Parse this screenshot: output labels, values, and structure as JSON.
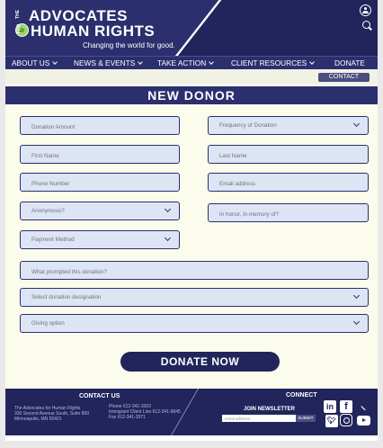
{
  "header": {
    "logo_the": "THE",
    "logo_line1": "ADVOCATES",
    "logo_for": "FOR",
    "logo_line2": "HUMAN RIGHTS",
    "tagline": "Changing the world for good."
  },
  "nav": {
    "items": [
      {
        "label": "ABOUT US"
      },
      {
        "label": "NEWS & EVENTS"
      },
      {
        "label": "TAKE ACTION"
      },
      {
        "label": "CLIENT RESOURCES"
      },
      {
        "label": "DONATE"
      }
    ]
  },
  "contact_button": "CONTACT",
  "page_title": "NEW DONOR",
  "form": {
    "donation_amount": "Donation Amount",
    "frequency": "Frequency of Donation",
    "first_name": "First Name",
    "last_name": "Last Name",
    "phone": "Phone Number",
    "email": "Email address",
    "anonymous": "Anonymous?",
    "in_honor": "In honor, in memory of?",
    "payment_method": "Payment Method",
    "prompted": "What prompted this donation?",
    "designation": "Select donation designation",
    "giving_option": "Giving option",
    "donate_button": "DONATE NOW"
  },
  "footer": {
    "contact_title": "CONTACT US",
    "address_line1": "The Advocates for Human Rights",
    "address_line2": "330 Second Avenue South, Suite 800",
    "address_line3": "Minneapolis, MN 55401",
    "phone_line1": "Phone 612-341-3302",
    "phone_line2": "Immigrant Client Line 612-341-9845",
    "phone_line3": "Fax 612-341-2971",
    "connect_title": "CONNECT",
    "newsletter_title": "JOIN NEWSLETTER",
    "newsletter_placeholder": "email address",
    "submit_label": "SUBMIT",
    "social_icons": [
      "linkedin-icon",
      "facebook-icon",
      "blog-icon",
      "twitter-icon",
      "instagram-icon",
      "youtube-icon"
    ]
  },
  "colors": {
    "navy": "#2b2f6e",
    "dark_navy": "#22255c",
    "field_bg": "#dde4f4",
    "page_bg": "#fcfcec",
    "globe_green": "#9fd36b"
  }
}
